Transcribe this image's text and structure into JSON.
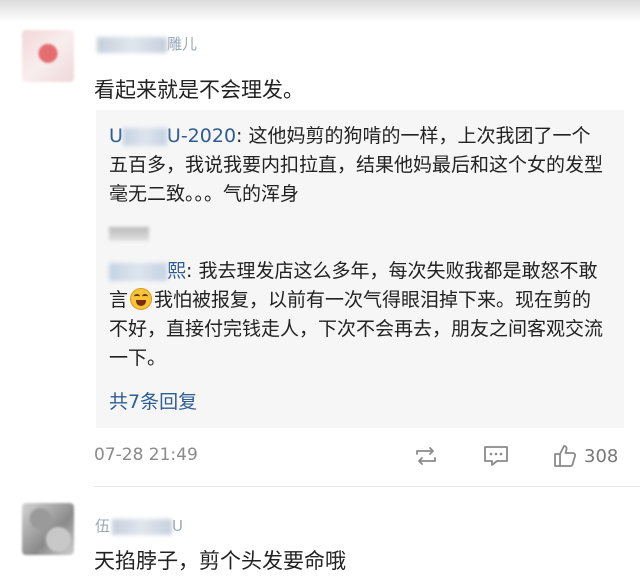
{
  "comments": [
    {
      "username_pre": "",
      "username_post": "雕儿",
      "text": "看起来就是不会理发。",
      "timestamp": "07-28 21:49",
      "like_count": "308",
      "replies": [
        {
          "user_pre": "U",
          "user_post": "U-2020",
          "text": ": 这他妈剪的狗啃的一样，上次我团了一个五百多，我说我要内扣拉直，结果他妈最后和这个女的发型毫无二致。。。气的浑身"
        },
        {
          "user_pre": "",
          "user_post": "熙",
          "text_before": ": 我去理发店这么多年，每次失败我都是敢怒不敢言",
          "text_after": "我怕被报复，以前有一次气得眼泪掉下来。现在剪的不好，直接付完钱走人，下次不会再去，朋友之间客观交流一下。"
        }
      ],
      "more_replies": "共7条回复"
    },
    {
      "username_pre": "伍",
      "username_post": "U",
      "text": "天掐脖子，剪个头发要命哦"
    }
  ],
  "icons": {
    "repost": "repost-icon",
    "reply": "comment-icon",
    "like": "thumbs-up-icon",
    "emoji": "grinning-sweat-emoji-icon"
  },
  "colors": {
    "link": "#2f5d93",
    "reply_bg": "#f6f6f6",
    "meta": "#8a8a8a"
  }
}
